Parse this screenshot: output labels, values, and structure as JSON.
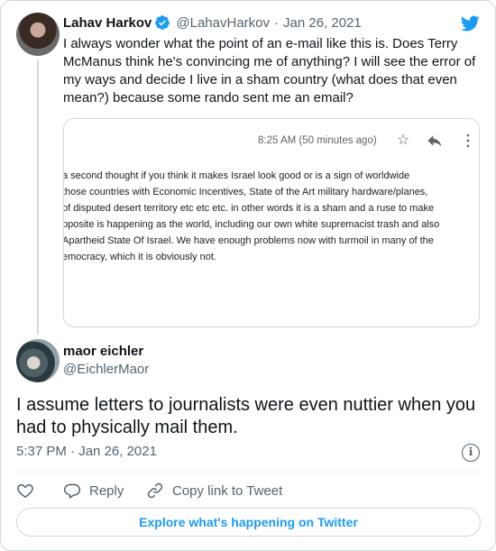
{
  "quoted_tweet": {
    "author_name": "Lahav Harkov",
    "handle": "@LahavHarkov",
    "separator": "·",
    "date": "Jan 26, 2021",
    "text": "I always wonder what the point of an e-mail like this is. Does Terry McManus think he's convincing me of anything? I will see the error of my ways and decide I live in a sham country (what does that even mean?) because some rando sent me an email?",
    "verified": true,
    "media": {
      "email_time": "8:25 AM (50 minutes ago)",
      "icons": [
        "star-icon",
        "reply-icon",
        "more-vertical-icon"
      ],
      "lines": [
        "a second thought if you think it makes Israel look good or is a sign of worldwide",
        " those countries with Economic Incentives, State of the Art military hardware/planes,",
        " of disputed desert territory etc etc etc.  in other words it is a sham and a ruse to make",
        "pposite is happening as the world, including our own white supremacist trash and also",
        " Apartheid State Of Israel.  We have enough problems now with turmoil in many of the",
        "emocracy, which it is obviously not."
      ]
    }
  },
  "reply_tweet": {
    "author_name": "maor eichler",
    "handle": "@EichlerMaor",
    "text": "I assume letters to journalists were even nuttier when you had to physically mail them.",
    "time": "5:37 PM",
    "separator": "·",
    "date": "Jan 26, 2021"
  },
  "actions": {
    "reply_label": "Reply",
    "copy_link_label": "Copy link to Tweet"
  },
  "explore_label": "Explore what's happening on Twitter",
  "colors": {
    "twitter_blue": "#1d9bf0",
    "secondary_text": "#536471",
    "border": "#cfd9de"
  }
}
